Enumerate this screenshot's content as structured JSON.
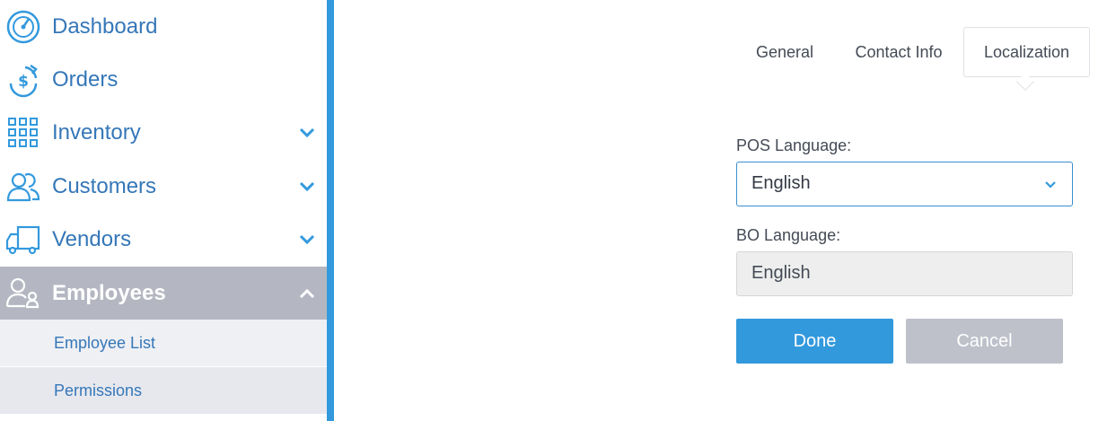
{
  "sidebar": {
    "items": [
      {
        "label": "Dashboard",
        "icon": "dashboard-gauge-icon"
      },
      {
        "label": "Orders",
        "icon": "dollar-refresh-icon"
      },
      {
        "label": "Inventory",
        "icon": "grid-icon",
        "expandable": true
      },
      {
        "label": "Customers",
        "icon": "users-icon",
        "expandable": true
      },
      {
        "label": "Vendors",
        "icon": "truck-icon",
        "expandable": true
      },
      {
        "label": "Employees",
        "icon": "employees-icon",
        "expandable": true,
        "expanded": true,
        "active": true
      }
    ],
    "sub_items": [
      {
        "label": "Employee List"
      },
      {
        "label": "Permissions"
      }
    ]
  },
  "tabs": [
    {
      "label": "General",
      "active": false
    },
    {
      "label": "Contact Info",
      "active": false
    },
    {
      "label": "Localization",
      "active": true
    }
  ],
  "form": {
    "pos_language_label": "POS Language:",
    "pos_language_value": "English",
    "bo_language_label": "BO Language:",
    "bo_language_value": "English",
    "done_label": "Done",
    "cancel_label": "Cancel"
  },
  "colors": {
    "accent": "#3399dd",
    "nav_text": "#3577b8",
    "active_nav_bg": "#b4b7c1",
    "cancel_bg": "#bec1ca"
  }
}
